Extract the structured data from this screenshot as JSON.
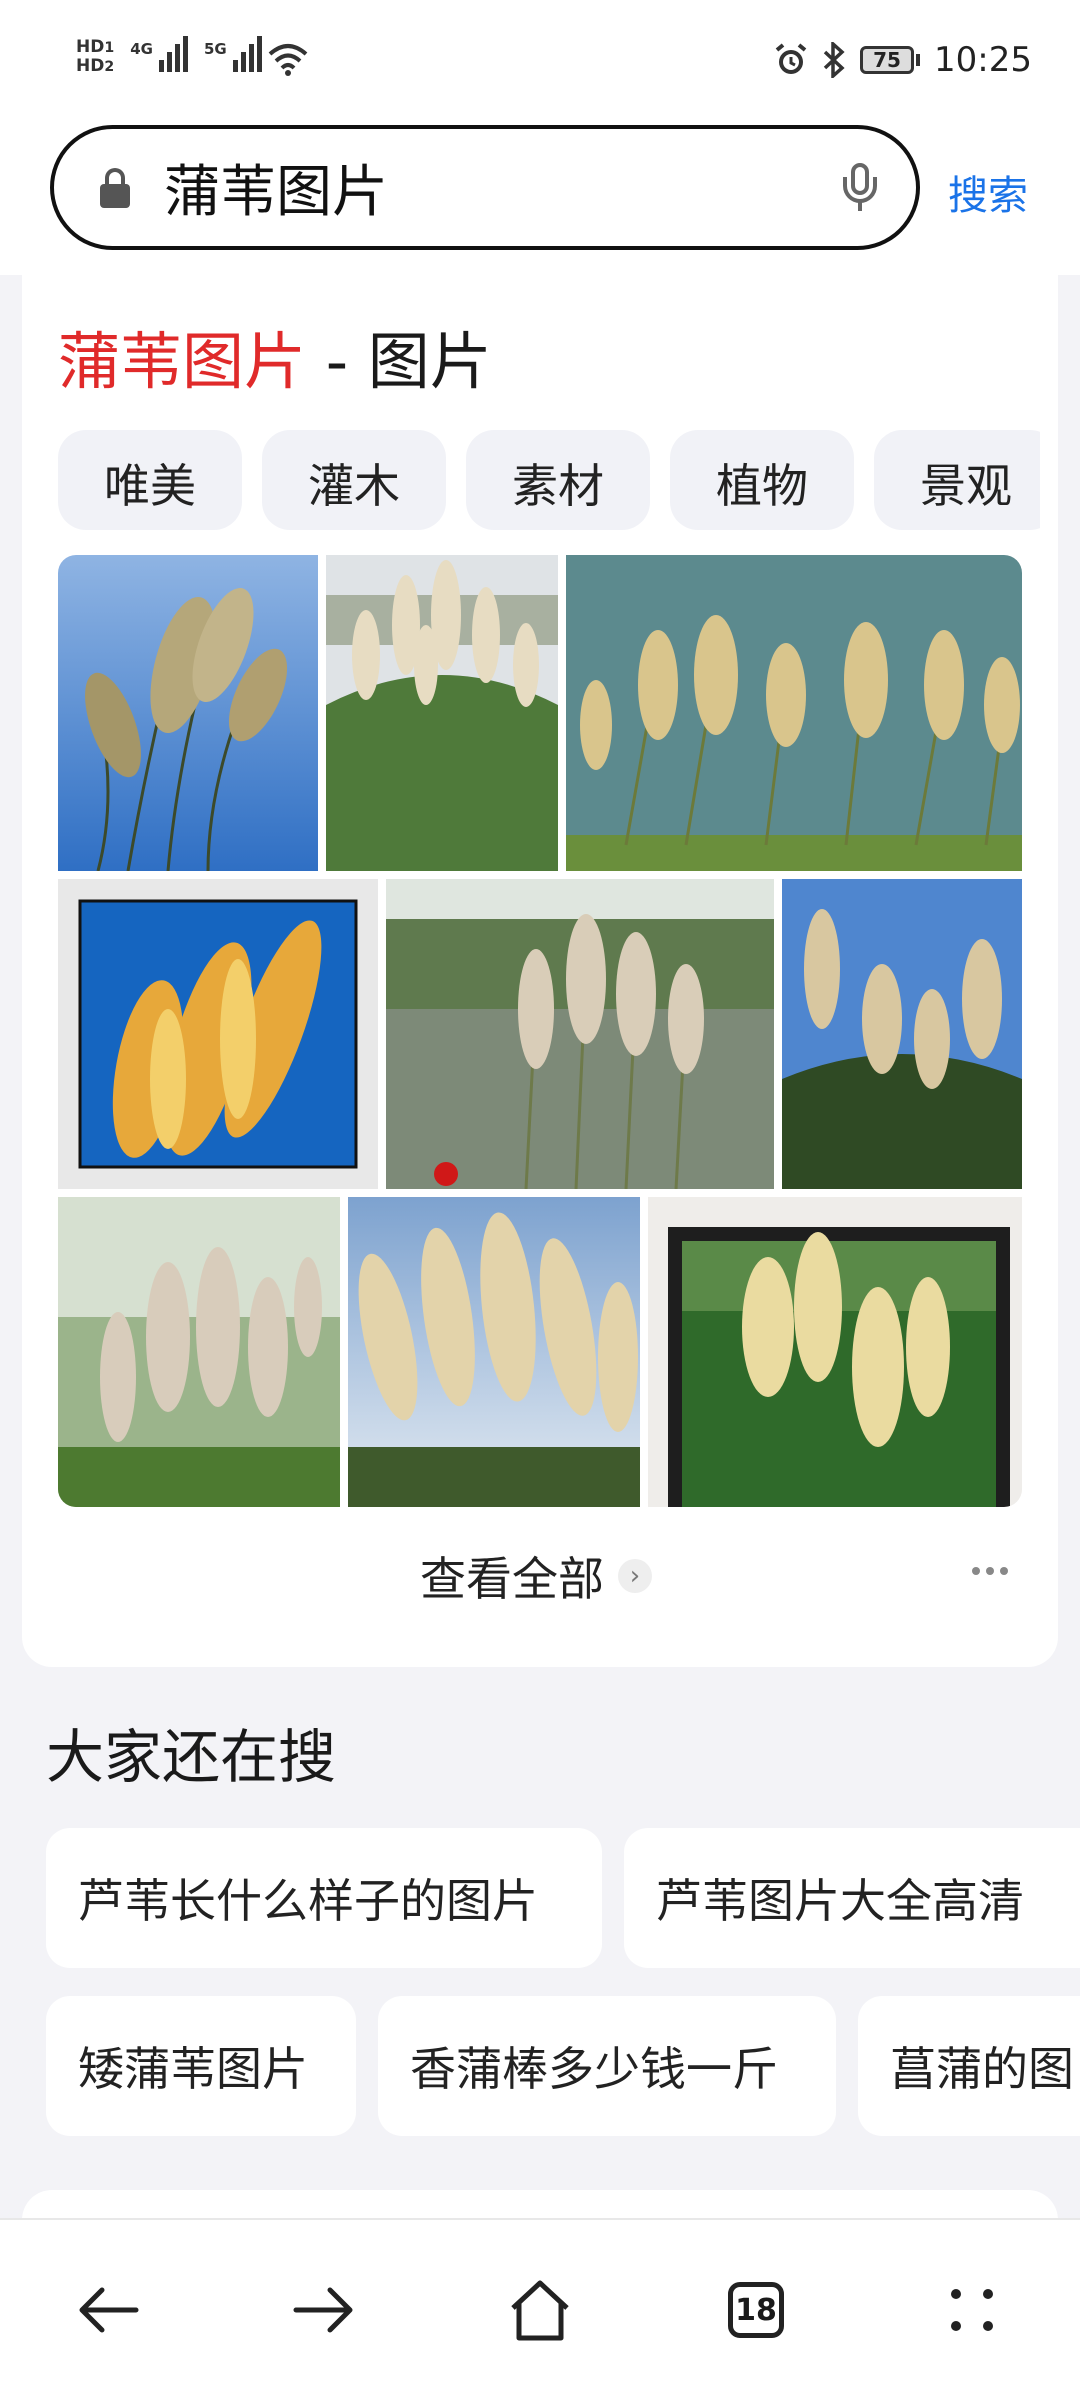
{
  "status_bar": {
    "hd1": "HD",
    "hd1_sub": "1",
    "hd2": "HD",
    "hd2_sub": "2",
    "net1": "4G",
    "net2": "5G",
    "battery": "75",
    "time": "10:25",
    "icons": [
      "signal-icon",
      "wifi-icon",
      "alarm-icon",
      "bluetooth-icon",
      "battery-icon"
    ]
  },
  "search": {
    "query": "蒲苇图片",
    "button_label": "搜索"
  },
  "images_card": {
    "title_highlight": "蒲苇图片",
    "title_rest": " - 图片",
    "chips": [
      "唯美",
      "灌木",
      "素材",
      "植物",
      "景观"
    ],
    "view_all": "查看全部"
  },
  "related": {
    "title": "大家还在搜",
    "row1": [
      "芦苇长什么样子的图片",
      "芦苇图片大全高清"
    ],
    "row2": [
      "矮蒲苇图片",
      "香蒲棒多少钱一斤",
      "菖蒲的图"
    ]
  },
  "bottom_nav": {
    "tab_count": "18",
    "icons": [
      "back-arrow-icon",
      "forward-arrow-icon",
      "home-icon",
      "tabs-icon",
      "menu-icon"
    ]
  },
  "colors": {
    "accent": "#1a73e8",
    "highlight": "#e02a2a",
    "background": "#f3f3f7"
  }
}
